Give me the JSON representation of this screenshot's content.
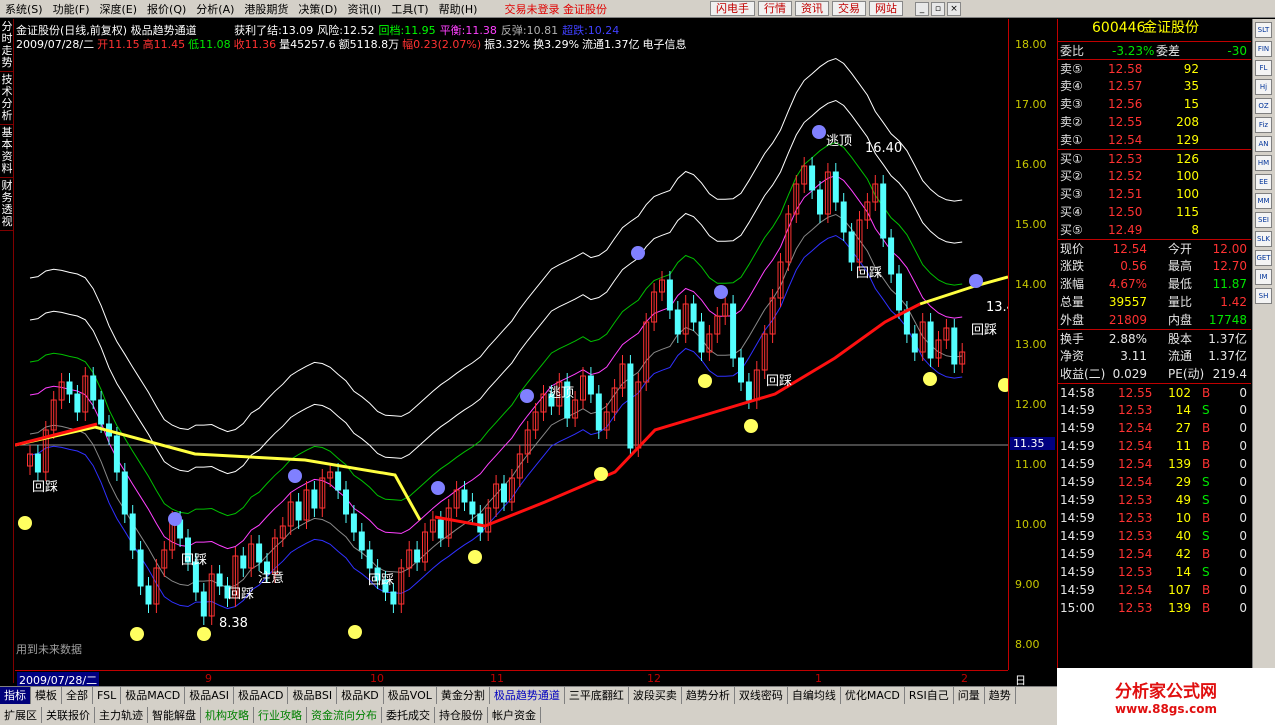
{
  "menu": [
    "系统(S)",
    "功能(F)",
    "深度(E)",
    "报价(Q)",
    "分析(A)",
    "港股期货",
    "决策(D)",
    "资讯(I)",
    "工具(T)",
    "帮助(H)"
  ],
  "status_text": "交易未登录  金证股份",
  "toolbar_buttons": [
    "闪电手",
    "行情",
    "资讯",
    "交易",
    "网站"
  ],
  "window_controls": [
    "_",
    "▫",
    "×"
  ],
  "left_nav": [
    "分时走势",
    "技术分析",
    "基本资料",
    "财务透视"
  ],
  "chart_title": "金证股份(日线,前复权) 极品趋势通道",
  "indicator_values": [
    {
      "label": "获利了结:13.09",
      "color": "#ffffff"
    },
    {
      "label": "风险:12.52",
      "color": "#ffffff"
    },
    {
      "label": "回档:11.95",
      "color": "#00ff00"
    },
    {
      "label": "平衡:11.38",
      "color": "#ff40ff"
    },
    {
      "label": "反弹:10.81",
      "color": "#b0b0b0"
    },
    {
      "label": "超跌:10.24",
      "color": "#4040ff"
    }
  ],
  "info_line": [
    {
      "t": "2009/07/28/二",
      "c": "#ffffff"
    },
    {
      "t": "开11.15",
      "c": "#ff3232"
    },
    {
      "t": "高11.45",
      "c": "#ff3232"
    },
    {
      "t": "低11.08",
      "c": "#00e600"
    },
    {
      "t": "收11.36",
      "c": "#ff3232"
    },
    {
      "t": "量45257.6",
      "c": "#ffffff"
    },
    {
      "t": "额5118.8万",
      "c": "#ffffff"
    },
    {
      "t": "幅0.23(2.07%)",
      "c": "#ff3232"
    },
    {
      "t": "振3.32%",
      "c": "#ffffff"
    },
    {
      "t": "换3.29%",
      "c": "#ffffff"
    },
    {
      "t": "流通1.37亿",
      "c": "#ffffff"
    },
    {
      "t": "电子信息",
      "c": "#ffffff"
    }
  ],
  "price_ticks": [
    "18.00",
    "17.00",
    "16.00",
    "15.00",
    "14.00",
    "13.00",
    "12.00",
    "11.00",
    "10.00",
    "9.00",
    "8.00"
  ],
  "current_price_tag": "11.35",
  "chart_annotations": [
    "逃顶",
    "逃顶",
    "16.40",
    "回踩",
    "回踩",
    "回踩",
    "回踩",
    "回踩",
    "注意",
    "13.4",
    "8.38",
    "回踩",
    "回踩",
    "用到未来数据"
  ],
  "date_axis": {
    "start": "2009/07/28/二",
    "months": [
      "9",
      "10",
      "11",
      "12",
      "1",
      "2"
    ],
    "period": "日线"
  },
  "quote": {
    "code": "600446",
    "name": "金证股份",
    "weibi_label": "委比",
    "weibi": "-3.23%",
    "weicha_label": "委差",
    "weicha": "-30",
    "asks": [
      {
        "l": "卖⑤",
        "p": "12.58",
        "v": "92"
      },
      {
        "l": "卖④",
        "p": "12.57",
        "v": "35"
      },
      {
        "l": "卖③",
        "p": "12.56",
        "v": "15"
      },
      {
        "l": "卖②",
        "p": "12.55",
        "v": "208"
      },
      {
        "l": "卖①",
        "p": "12.54",
        "v": "129"
      }
    ],
    "bids": [
      {
        "l": "买①",
        "p": "12.53",
        "v": "126"
      },
      {
        "l": "买②",
        "p": "12.52",
        "v": "100"
      },
      {
        "l": "买③",
        "p": "12.51",
        "v": "100"
      },
      {
        "l": "买④",
        "p": "12.50",
        "v": "115"
      },
      {
        "l": "买⑤",
        "p": "12.49",
        "v": "8"
      }
    ],
    "stats": [
      {
        "l1": "现价",
        "v1": "12.54",
        "c1": "red",
        "l2": "今开",
        "v2": "12.00",
        "c2": "red"
      },
      {
        "l1": "涨跌",
        "v1": "0.56",
        "c1": "red",
        "l2": "最高",
        "v2": "12.70",
        "c2": "red"
      },
      {
        "l1": "涨幅",
        "v1": "4.67%",
        "c1": "red",
        "l2": "最低",
        "v2": "11.87",
        "c2": "green"
      },
      {
        "l1": "总量",
        "v1": "39557",
        "c1": "yellow",
        "l2": "量比",
        "v2": "1.42",
        "c2": "red"
      },
      {
        "l1": "外盘",
        "v1": "21809",
        "c1": "red",
        "l2": "内盘",
        "v2": "17748",
        "c2": "green"
      }
    ],
    "fund": [
      {
        "l1": "换手",
        "v1": "2.88%",
        "l2": "股本",
        "v2": "1.37亿"
      },
      {
        "l1": "净资",
        "v1": "3.11",
        "l2": "流通",
        "v2": "1.37亿"
      },
      {
        "l1": "收益(二)",
        "v1": "0.029",
        "l2": "PE(动)",
        "v2": "219.4"
      }
    ],
    "trades": [
      {
        "t": "14:58",
        "p": "12.55",
        "v": "102",
        "s": "B",
        "n": "0"
      },
      {
        "t": "14:59",
        "p": "12.53",
        "v": "14",
        "s": "S",
        "n": "0"
      },
      {
        "t": "14:59",
        "p": "12.54",
        "v": "27",
        "s": "B",
        "n": "0"
      },
      {
        "t": "14:59",
        "p": "12.54",
        "v": "11",
        "s": "B",
        "n": "0"
      },
      {
        "t": "14:59",
        "p": "12.54",
        "v": "139",
        "s": "B",
        "n": "0"
      },
      {
        "t": "14:59",
        "p": "12.54",
        "v": "29",
        "s": "S",
        "n": "0"
      },
      {
        "t": "14:59",
        "p": "12.53",
        "v": "49",
        "s": "S",
        "n": "0"
      },
      {
        "t": "14:59",
        "p": "12.53",
        "v": "10",
        "s": "B",
        "n": "0"
      },
      {
        "t": "14:59",
        "p": "12.53",
        "v": "40",
        "s": "S",
        "n": "0"
      },
      {
        "t": "14:59",
        "p": "12.54",
        "v": "42",
        "s": "B",
        "n": "0"
      },
      {
        "t": "14:59",
        "p": "12.53",
        "v": "14",
        "s": "S",
        "n": "0"
      },
      {
        "t": "14:59",
        "p": "12.54",
        "v": "107",
        "s": "B",
        "n": "0"
      },
      {
        "t": "15:00",
        "p": "12.53",
        "v": "139",
        "s": "B",
        "n": "0"
      }
    ]
  },
  "tabs": [
    "指标",
    "模板",
    "全部",
    "FSL",
    "极品MACD",
    "极品ASI",
    "极品ACD",
    "极品BSI",
    "极品KD",
    "极品VOL",
    "黄金分割",
    "极品趋势通道",
    "三平底翻红",
    "波段买卖",
    "趋势分析",
    "双线密码",
    "自编均线",
    "优化MACD",
    "RSI自己",
    "问量",
    "趋势"
  ],
  "bottom_items": [
    "扩展区",
    "关联报价",
    "主力轨迹",
    "智能解盘",
    "机构攻略",
    "行业攻略",
    "资金流向分布",
    "委托成交",
    "持仓股份",
    "帐户资金"
  ],
  "logo": {
    "title": "分析家公式网",
    "url": "www.88gs.com"
  },
  "right_tools": [
    "SLT",
    "FIN",
    "FL",
    "Hj",
    "OZ",
    "Fiz",
    "AN",
    "HM",
    "EE",
    "MM",
    "SEI",
    "SLK",
    "GET",
    "IM",
    "SH"
  ],
  "colors": {
    "up": "#ff3232",
    "down": "#54ffff",
    "ma_yellow": "#ffff40",
    "ma_red": "#ff1010",
    "border": "#c00000"
  }
}
